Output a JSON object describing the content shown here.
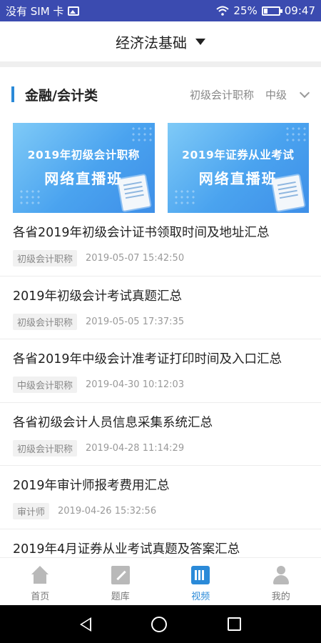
{
  "status_bar": {
    "carrier": "没有 SIM 卡",
    "battery": "25%",
    "time": "09:47"
  },
  "header": {
    "title": "经济法基础"
  },
  "category": {
    "title": "金融/会计类",
    "tags": [
      "初级会计职称",
      "中级"
    ]
  },
  "banners": [
    {
      "line1": "2019年初级会计职称",
      "line2": "网络直播班"
    },
    {
      "line1": "2019年证券从业考试",
      "line2": "网络直播班"
    }
  ],
  "articles": [
    {
      "title": "各省2019年初级会计证书领取时间及地址汇总",
      "tag": "初级会计职称",
      "time": "2019-05-07 15:42:50"
    },
    {
      "title": "2019年初级会计考试真题汇总",
      "tag": "初级会计职称",
      "time": "2019-05-05 17:37:35"
    },
    {
      "title": "各省2019年中级会计准考证打印时间及入口汇总",
      "tag": "中级会计职称",
      "time": "2019-04-30 10:12:03"
    },
    {
      "title": "各省初级会计人员信息采集系统汇总",
      "tag": "初级会计职称",
      "time": "2019-04-28 11:14:29"
    },
    {
      "title": "2019年审计师报考费用汇总",
      "tag": "审计师",
      "time": "2019-04-26 15:32:56"
    },
    {
      "title": "2019年4月证券从业考试真题及答案汇总",
      "tag": "",
      "time": ""
    }
  ],
  "tabbar": {
    "items": [
      {
        "label": "首页",
        "icon": "home-icon"
      },
      {
        "label": "题库",
        "icon": "edit-icon"
      },
      {
        "label": "视频",
        "icon": "video-icon",
        "active": true
      },
      {
        "label": "我的",
        "icon": "user-icon"
      }
    ]
  },
  "colors": {
    "status_bar": "#3b4bb0",
    "accent": "#2b8ad8"
  }
}
